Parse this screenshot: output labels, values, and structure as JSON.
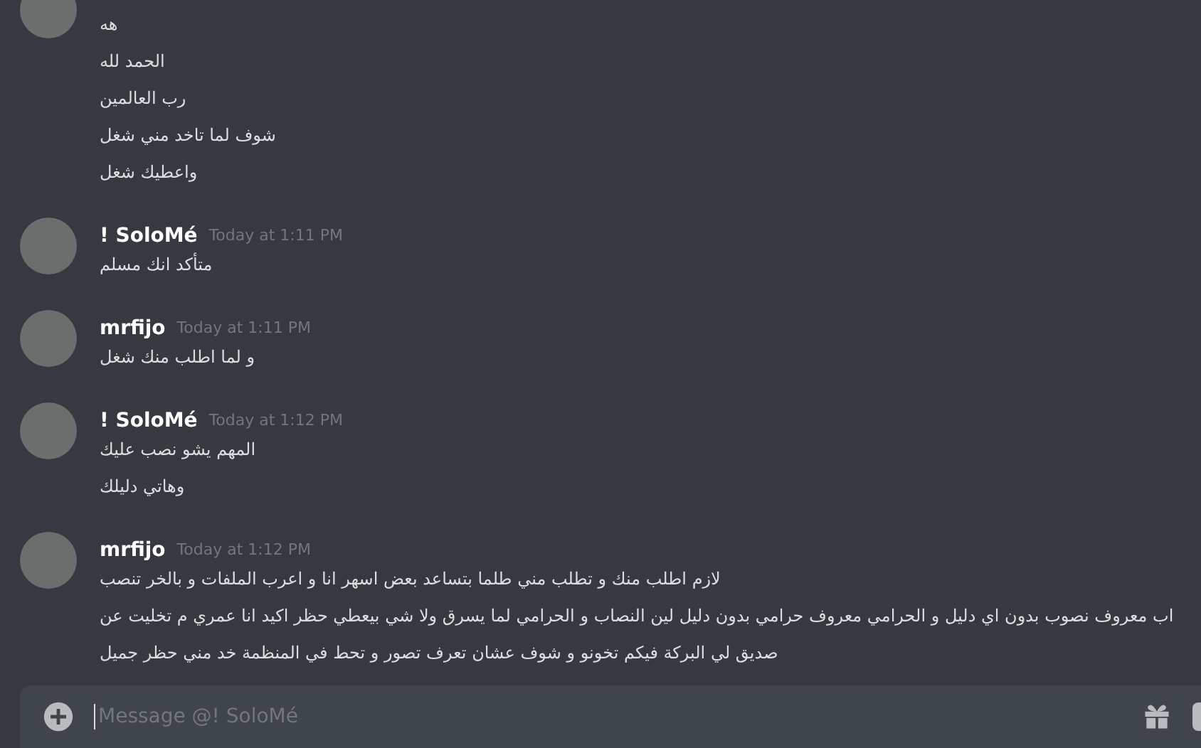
{
  "messages": [
    {
      "lines": [
        "هه",
        "الحمد لله",
        "رب العالمين",
        "شوف لما تاخد مني شغل",
        "واعطيك شغل"
      ]
    },
    {
      "author": "! SoloMé",
      "time": "Today at 1:11 PM",
      "lines": [
        "متأكد انك مسلم"
      ]
    },
    {
      "author": "mrfijo",
      "time": "Today at 1:11 PM",
      "lines": [
        "و لما اطلب منك شغل"
      ]
    },
    {
      "author": "! SoloMé",
      "time": "Today at 1:12 PM",
      "lines": [
        "المهم  يشو نصب عليك",
        "وهاتي دليلك"
      ]
    },
    {
      "author": "mrfijo",
      "time": "Today at 1:12 PM",
      "lines": [
        "لازم اطلب منك و تطلب مني طلما بتساعد بعض اسهر انا و اعرب الملفات و بالخر تنصب",
        "اب معروف نصوب بدون اي دليل و الحرامي معروف حرامي بدون دليل لين النصاب و الحرامي لما يسرق ولا شي بيعطي حظر اكيد انا عمري م تخليت عن",
        "صديق لي  البركة فيكم تخونو و شوف عشان تعرف تصور و تحط في المنظمة خد مني حظر جميل"
      ]
    }
  ],
  "composer": {
    "placeholder": "Message @! SoloMé"
  }
}
